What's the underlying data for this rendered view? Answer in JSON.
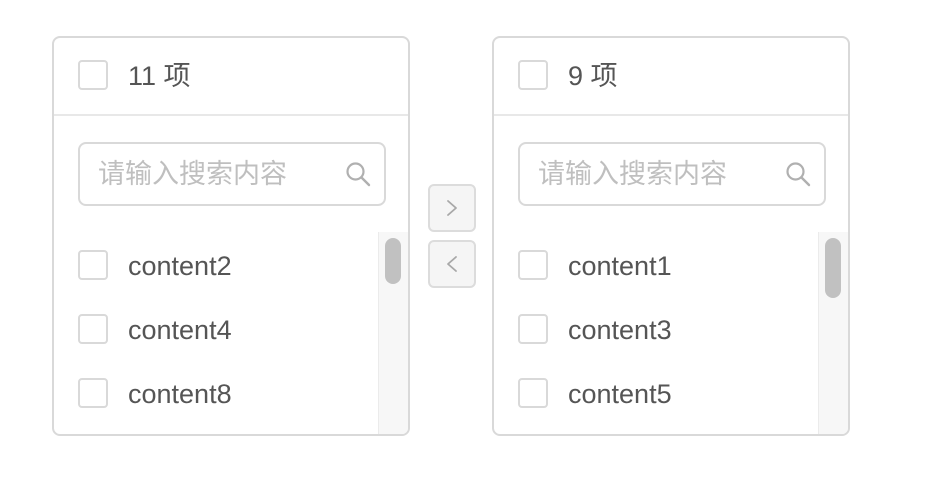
{
  "left_panel": {
    "count_label": "11 项",
    "search_placeholder": "请输入搜索内容",
    "items": [
      {
        "label": "content2"
      },
      {
        "label": "content4"
      },
      {
        "label": "content8"
      }
    ]
  },
  "right_panel": {
    "count_label": "9 项",
    "search_placeholder": "请输入搜索内容",
    "items": [
      {
        "label": "content1"
      },
      {
        "label": "content3"
      },
      {
        "label": "content5"
      }
    ]
  },
  "buttons": {
    "move_right_icon": "chevron-right-icon",
    "move_left_icon": "chevron-left-icon"
  },
  "colors": {
    "border": "#d9d9d9",
    "text": "#555555",
    "placeholder": "#bfbfbf",
    "button_bg": "#f5f5f5",
    "scroll_thumb": "#c1c1c1"
  }
}
